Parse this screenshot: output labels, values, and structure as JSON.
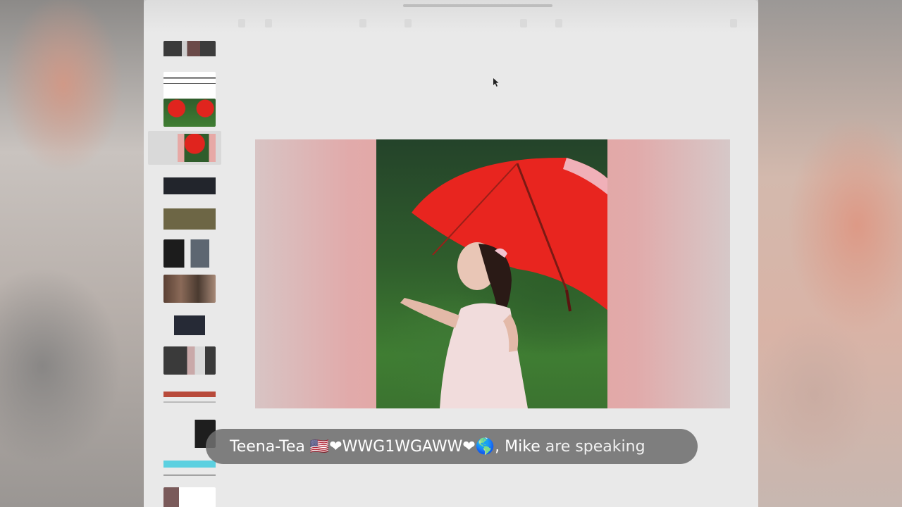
{
  "speaking_banner": {
    "names": "Teena-Tea 🇺🇸❤WWG1WGAWW❤🌎, Mike",
    "suffix": "are speaking"
  },
  "colors": {
    "banner_bg": "#6e6e6e",
    "umbrella_red": "#e8251f",
    "screen_bg": "#e9e9e9"
  },
  "thumbnails": [
    {
      "name": "thumb-1"
    },
    {
      "name": "thumb-2"
    },
    {
      "name": "thumb-3"
    },
    {
      "name": "thumb-4-active"
    },
    {
      "name": "thumb-5"
    },
    {
      "name": "thumb-6"
    },
    {
      "name": "thumb-7"
    },
    {
      "name": "thumb-8"
    },
    {
      "name": "thumb-9"
    },
    {
      "name": "thumb-10"
    },
    {
      "name": "thumb-11"
    },
    {
      "name": "thumb-12"
    },
    {
      "name": "thumb-13"
    },
    {
      "name": "thumb-14"
    }
  ],
  "icons": {
    "cursor": "pointer-cursor-icon"
  }
}
